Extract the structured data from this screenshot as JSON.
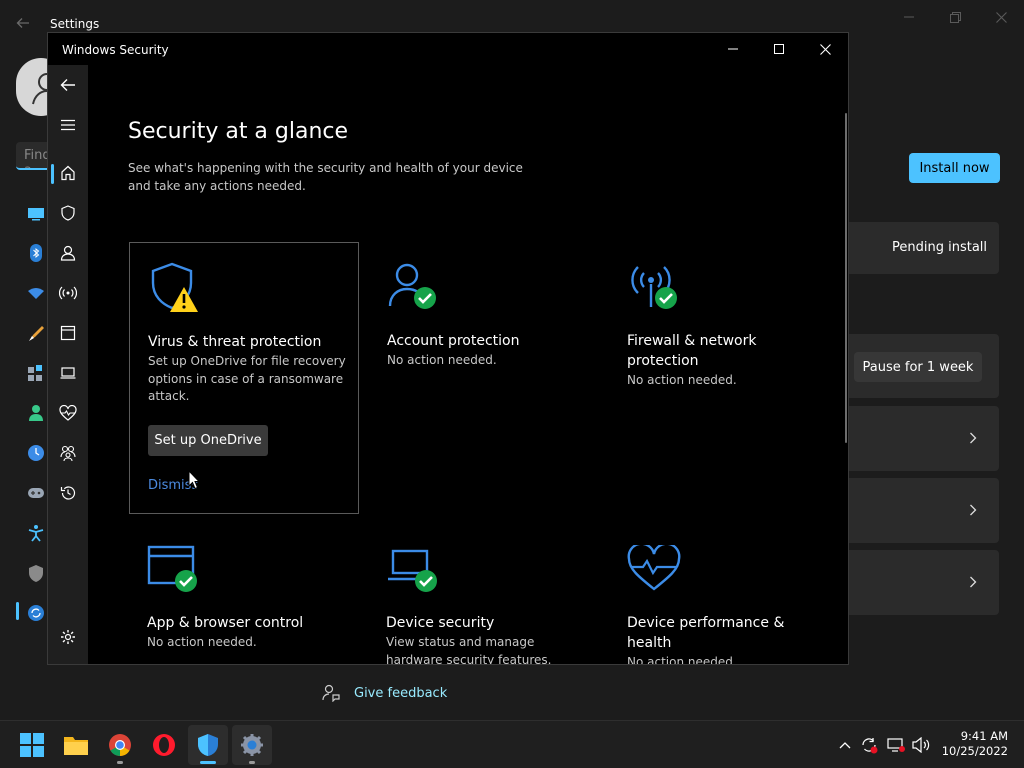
{
  "settings": {
    "title": "Settings",
    "search_placeholder": "Find a setting",
    "install_now_label": "Install now",
    "pending_install": "Pending install",
    "pause_label": "Pause for 1 week",
    "give_feedback": "Give feedback"
  },
  "security": {
    "window_title": "Windows Security",
    "page_title": "Security at a glance",
    "page_desc": "See what's happening with the security and health of your device and take any actions needed.",
    "nav_icons": [
      "back-arrow-icon",
      "hamburger-icon",
      "home-icon",
      "shield-icon",
      "person-icon",
      "wifi-antenna-icon",
      "app-browser-icon",
      "laptop-icon",
      "heart-pulse-icon",
      "family-icon",
      "history-icon",
      "gear-icon"
    ],
    "cards": [
      {
        "title": "Virus & threat protection",
        "status": "Set up OneDrive for file recovery options in case of a ransomware attack.",
        "action": "Set up OneDrive",
        "dismiss": "Dismiss",
        "icon": "shield-warning-icon"
      },
      {
        "title": "Account protection",
        "status": "No action needed.",
        "icon": "account-check-icon"
      },
      {
        "title": "Firewall & network protection",
        "status": "No action needed.",
        "icon": "firewall-check-icon"
      },
      {
        "title": "App & browser control",
        "status": "No action needed.",
        "icon": "app-browser-check-icon"
      },
      {
        "title": "Device security",
        "status": "View status and manage hardware security features.",
        "icon": "laptop-security-icon"
      },
      {
        "title": "Device performance & health",
        "status": "No action needed.",
        "icon": "heart-pulse-icon"
      }
    ]
  },
  "colors": {
    "accent": "#4cc2ff",
    "icon_blue": "#3c8ce7",
    "check_green": "#16a34a",
    "warning_yellow": "#ffd11a",
    "link_blue": "#4c8be0"
  },
  "taskbar": {
    "apps": [
      "start-icon",
      "file-explorer-icon",
      "chrome-icon",
      "opera-icon",
      "windows-security-icon",
      "settings-icon"
    ],
    "time": "9:41 AM",
    "date": "10/25/2022"
  }
}
